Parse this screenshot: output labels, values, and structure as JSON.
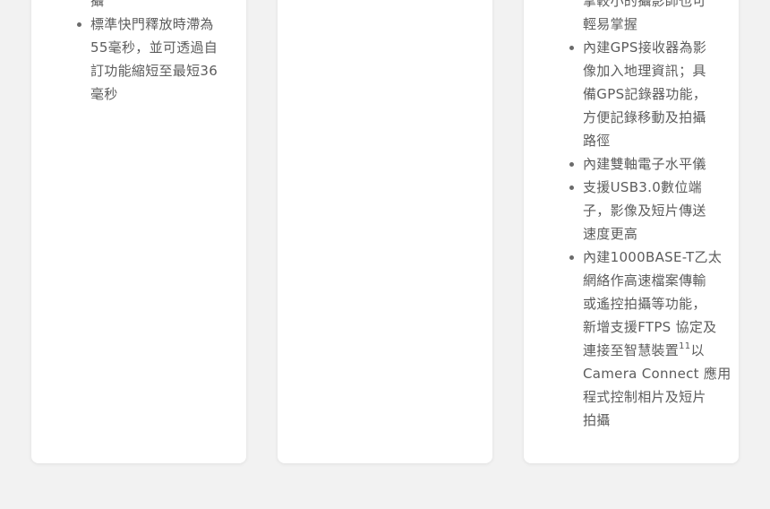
{
  "cards": [
    {
      "items": [
        {
          "continued": true,
          "lines": [
            "攝"
          ]
        },
        {
          "continued": false,
          "lines": [
            "標準快門釋放時滯為",
            "55毫秒，並可透過自",
            "訂功能縮短至最短36",
            "毫秒"
          ]
        }
      ]
    },
    {
      "items": []
    },
    {
      "items": [
        {
          "continued": true,
          "lines": [
            "拿較小的攝影師也可",
            "輕易掌握"
          ]
        },
        {
          "continued": false,
          "lines": [
            "內建GPS接收器為影",
            "像加入地理資訊；具",
            "備GPS記錄器功能，",
            "方便記錄移動及拍攝",
            "路徑"
          ]
        },
        {
          "continued": false,
          "lines": [
            "內建雙軸電子水平儀"
          ]
        },
        {
          "continued": false,
          "lines": [
            "支援USB3.0數位端",
            "子，影像及短片傳送",
            "速度更高"
          ]
        },
        {
          "continued": false,
          "lines": [
            "內建1000BASE-T乙太",
            "網絡作高速檔案傳輸",
            "或遙控拍攝等功能，",
            "新增支援FTPS 協定及"
          ],
          "sup_line": {
            "before": "連接至智慧裝置",
            "sup": "11",
            "after": "以"
          },
          "tail_lines": [
            "Camera Connect 應用",
            "程式控制相片及短片",
            "拍攝"
          ]
        }
      ]
    }
  ],
  "colors": {
    "page_background": "#f2f2f2",
    "card_background": "#ffffff",
    "text": "#5c5c5c",
    "bullet": "#6b6b6b"
  }
}
